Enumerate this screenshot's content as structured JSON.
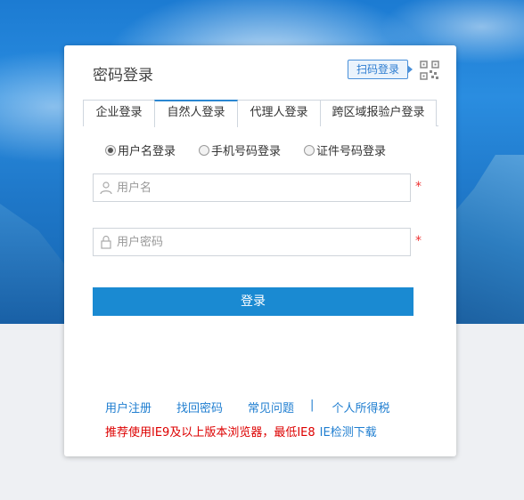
{
  "card": {
    "title": "密码登录",
    "qr_login_label": "扫码登录"
  },
  "tabs": [
    {
      "label": "企业登录",
      "active": false
    },
    {
      "label": "自然人登录",
      "active": true
    },
    {
      "label": "代理人登录",
      "active": false
    },
    {
      "label": "跨区域报验户登录",
      "active": false
    }
  ],
  "radios": [
    {
      "label": "用户名登录",
      "checked": true
    },
    {
      "label": "手机号码登录",
      "checked": false
    },
    {
      "label": "证件号码登录",
      "checked": false
    }
  ],
  "fields": {
    "username": {
      "placeholder": "用户名",
      "value": "",
      "required_mark": "*"
    },
    "password": {
      "placeholder": "用户密码",
      "value": "",
      "required_mark": "*"
    }
  },
  "login_button": "登录",
  "links": {
    "register": "用户注册",
    "recover": "找回密码",
    "faq": "常见问题",
    "separator": "|",
    "income_tax": "个人所得税"
  },
  "notice": {
    "text": "推荐使用IE9及以上版本浏览器，最低IE8",
    "ie_link": "IE检测下载"
  },
  "colors": {
    "accent": "#1a8ad2",
    "link": "#1f7ed0",
    "warning": "#dd0000"
  }
}
